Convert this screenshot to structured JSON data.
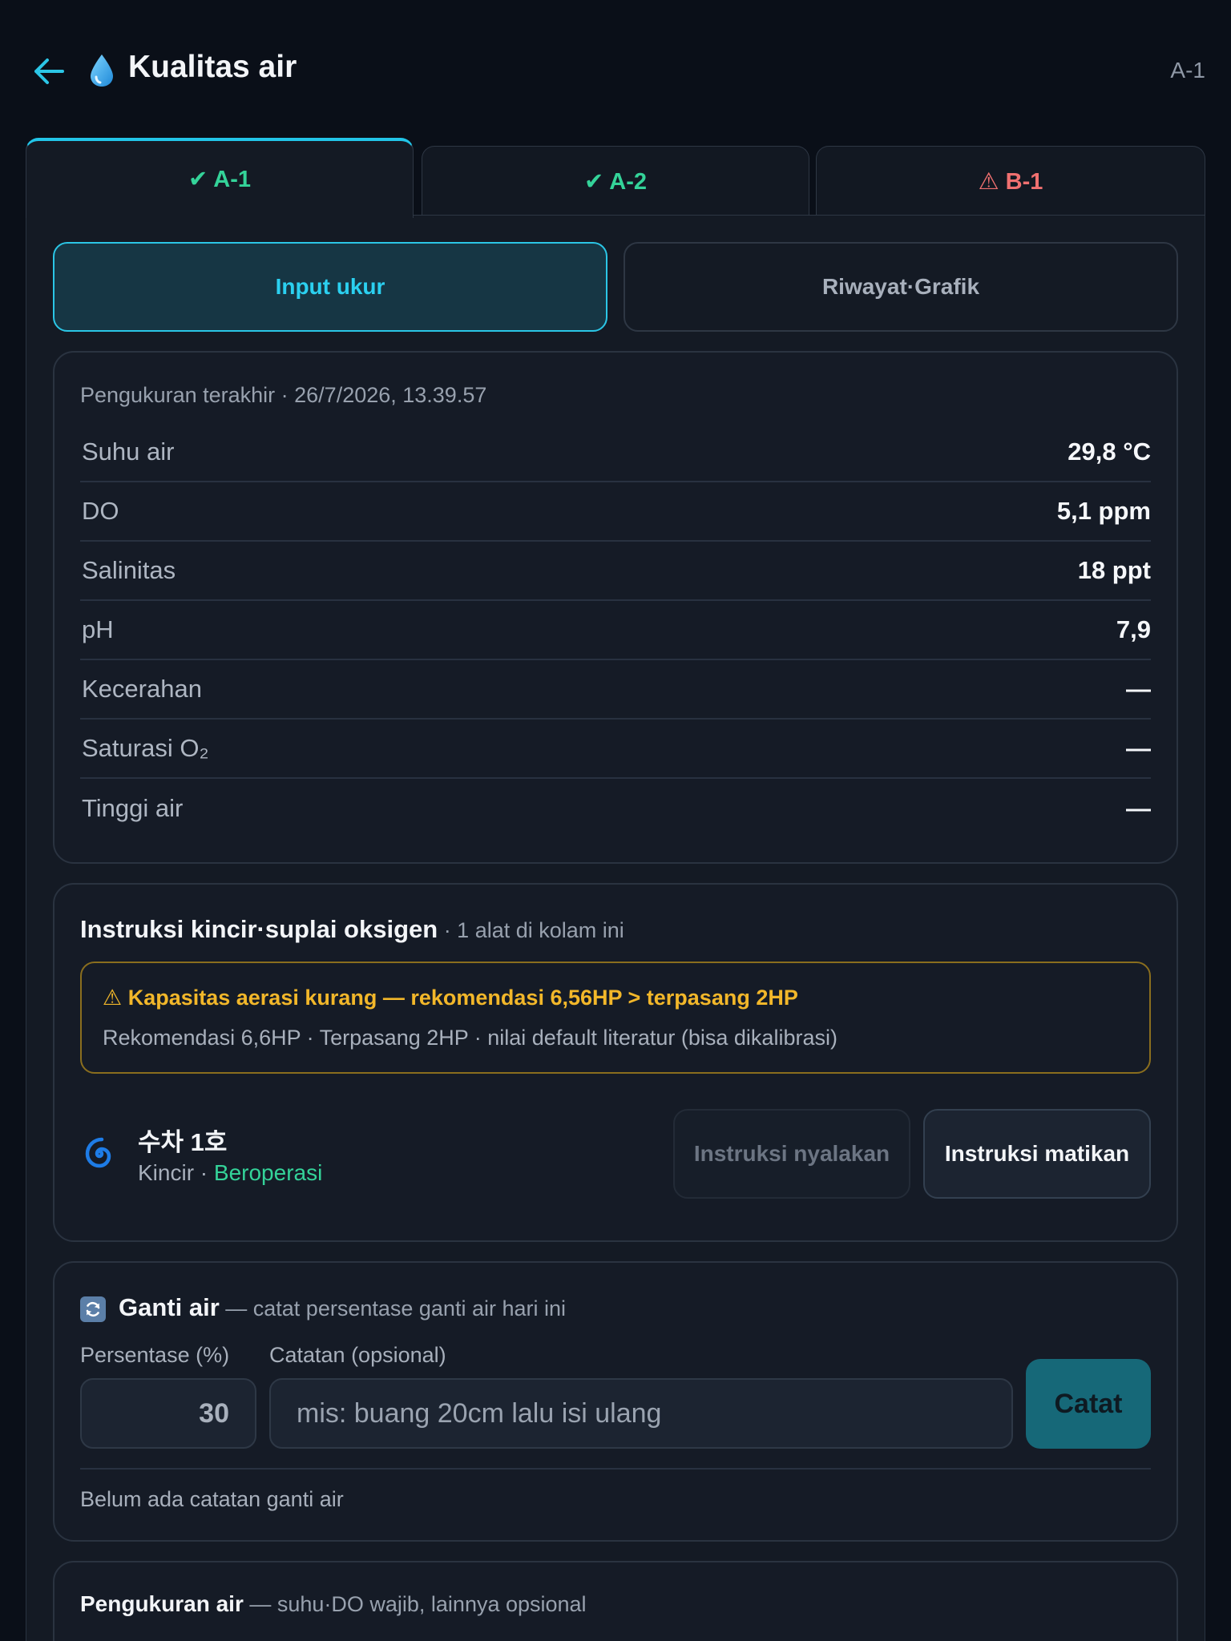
{
  "header": {
    "title": "Kualitas air",
    "pond_code": "A-1"
  },
  "pond_tabs": [
    {
      "label": "✔ A-1",
      "status": "ok",
      "active": true
    },
    {
      "label": "✔ A-2",
      "status": "ok",
      "active": false
    },
    {
      "label": "⚠ B-1",
      "status": "warn",
      "active": false
    }
  ],
  "mode_tabs": [
    {
      "label": "Input ukur",
      "active": true
    },
    {
      "label": "Riwayat·Grafik",
      "active": false
    }
  ],
  "last_measurement": {
    "label": "Pengukuran terakhir · 26/7/2026, 13.39.57",
    "rows": [
      {
        "label": "Suhu air",
        "value": "29,8 °C"
      },
      {
        "label": "DO",
        "value": "5,1 ppm"
      },
      {
        "label": "Salinitas",
        "value": "18 ppt"
      },
      {
        "label": "pH",
        "value": "7,9"
      },
      {
        "label": "Kecerahan",
        "value": "—"
      },
      {
        "label": "Saturasi O₂",
        "value": "—"
      },
      {
        "label": "Tinggi air",
        "value": "—"
      }
    ]
  },
  "aeration": {
    "title": "Instruksi kincir·suplai oksigen",
    "subtitle": " · 1 alat di kolam ini",
    "alert_title": "⚠ Kapasitas aerasi kurang — rekomendasi 6,56HP > terpasang 2HP",
    "alert_desc": "Rekomendasi 6,6HP · Terpasang 2HP · nilai default literatur (bisa dikalibrasi)",
    "device": {
      "name": "수차 1호",
      "type": "Kincir · ",
      "status": "Beroperasi"
    },
    "btn_on": "Instruksi nyalakan",
    "btn_off": "Instruksi matikan"
  },
  "water_change": {
    "title": "Ganti air",
    "subtitle": " — catat persentase ganti air hari ini",
    "pct_label": "Persentase (%)",
    "note_label": "Catatan (opsional)",
    "pct_value": "30",
    "note_placeholder": "mis: buang 20cm lalu isi ulang",
    "submit_label": "Catat",
    "empty_text": "Belum ada catatan ganti air"
  },
  "measurement_form": {
    "title": "Pengukuran air",
    "subtitle": " — suhu·DO wajib, lainnya opsional"
  },
  "colors": {
    "accent": "#22c5e8",
    "ok": "#34d399",
    "warn": "#f07070",
    "alert": "#f2b72a"
  }
}
